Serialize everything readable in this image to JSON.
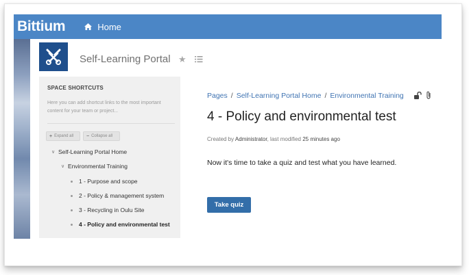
{
  "header": {
    "logo": "Bittium",
    "home_label": "Home"
  },
  "space": {
    "title": "Self-Learning Portal"
  },
  "sidebar": {
    "shortcuts_title": "SPACE SHORTCUTS",
    "shortcuts_desc": "Here you can add shortcut links to the most important content for your team or project...",
    "expand_all": "Expand all",
    "collapse_all": "Collapse all",
    "tree": {
      "root": "Self-Learning Portal Home",
      "child": "Environmental Training",
      "pages": [
        "1 - Purpose and scope",
        "2 - Policy & management system",
        "3 - Recycling in Oulu Site",
        "4 - Policy and environmental test"
      ]
    }
  },
  "breadcrumb": [
    "Pages",
    "Self-Learning Portal Home",
    "Environmental Training"
  ],
  "page": {
    "title": "4 - Policy and environmental test",
    "meta_created_by": "Created by",
    "meta_author": "Administrator",
    "meta_modified": ", last modified",
    "meta_time": "25 minutes ago",
    "body": "Now it's time to take a quiz and test what you have learned.",
    "button": "Take quiz"
  },
  "colors": {
    "header": "#4b86c6",
    "link": "#3f73b2",
    "button": "#336ea9",
    "space_logo": "#1f4f8c"
  },
  "icons": [
    "home-icon",
    "star-icon",
    "list-icon",
    "unlock-icon",
    "attachment-icon"
  ]
}
